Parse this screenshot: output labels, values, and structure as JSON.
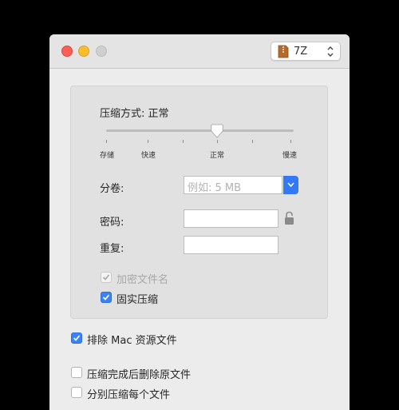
{
  "window": {
    "format_label": "7Z"
  },
  "compression": {
    "label": "压缩方式: 正常",
    "slider_level_fraction": 0.62,
    "ticks": [
      "存储",
      "快速",
      "正常",
      "慢速"
    ]
  },
  "volume": {
    "label": "分卷:",
    "placeholder": "例如: 5 MB"
  },
  "password": {
    "label": "密码:",
    "value": ""
  },
  "repeat": {
    "label": "重复:",
    "value": ""
  },
  "options": {
    "encrypt_filenames": {
      "label": "加密文件名",
      "checked": true,
      "enabled": false
    },
    "solid_compression": {
      "label": "固实压缩",
      "checked": true,
      "enabled": true
    },
    "exclude_mac_resources": {
      "label": "排除 Mac 资源文件",
      "checked": true
    },
    "delete_after": {
      "label": "压缩完成后删除原文件",
      "checked": false
    },
    "separate_each": {
      "label": "分别压缩每个文件",
      "checked": false
    }
  },
  "colors": {
    "accent": "#3478f6",
    "close": "#fd5f57",
    "minimize": "#febc2e",
    "zoom_disabled": "#cfcfcf"
  }
}
